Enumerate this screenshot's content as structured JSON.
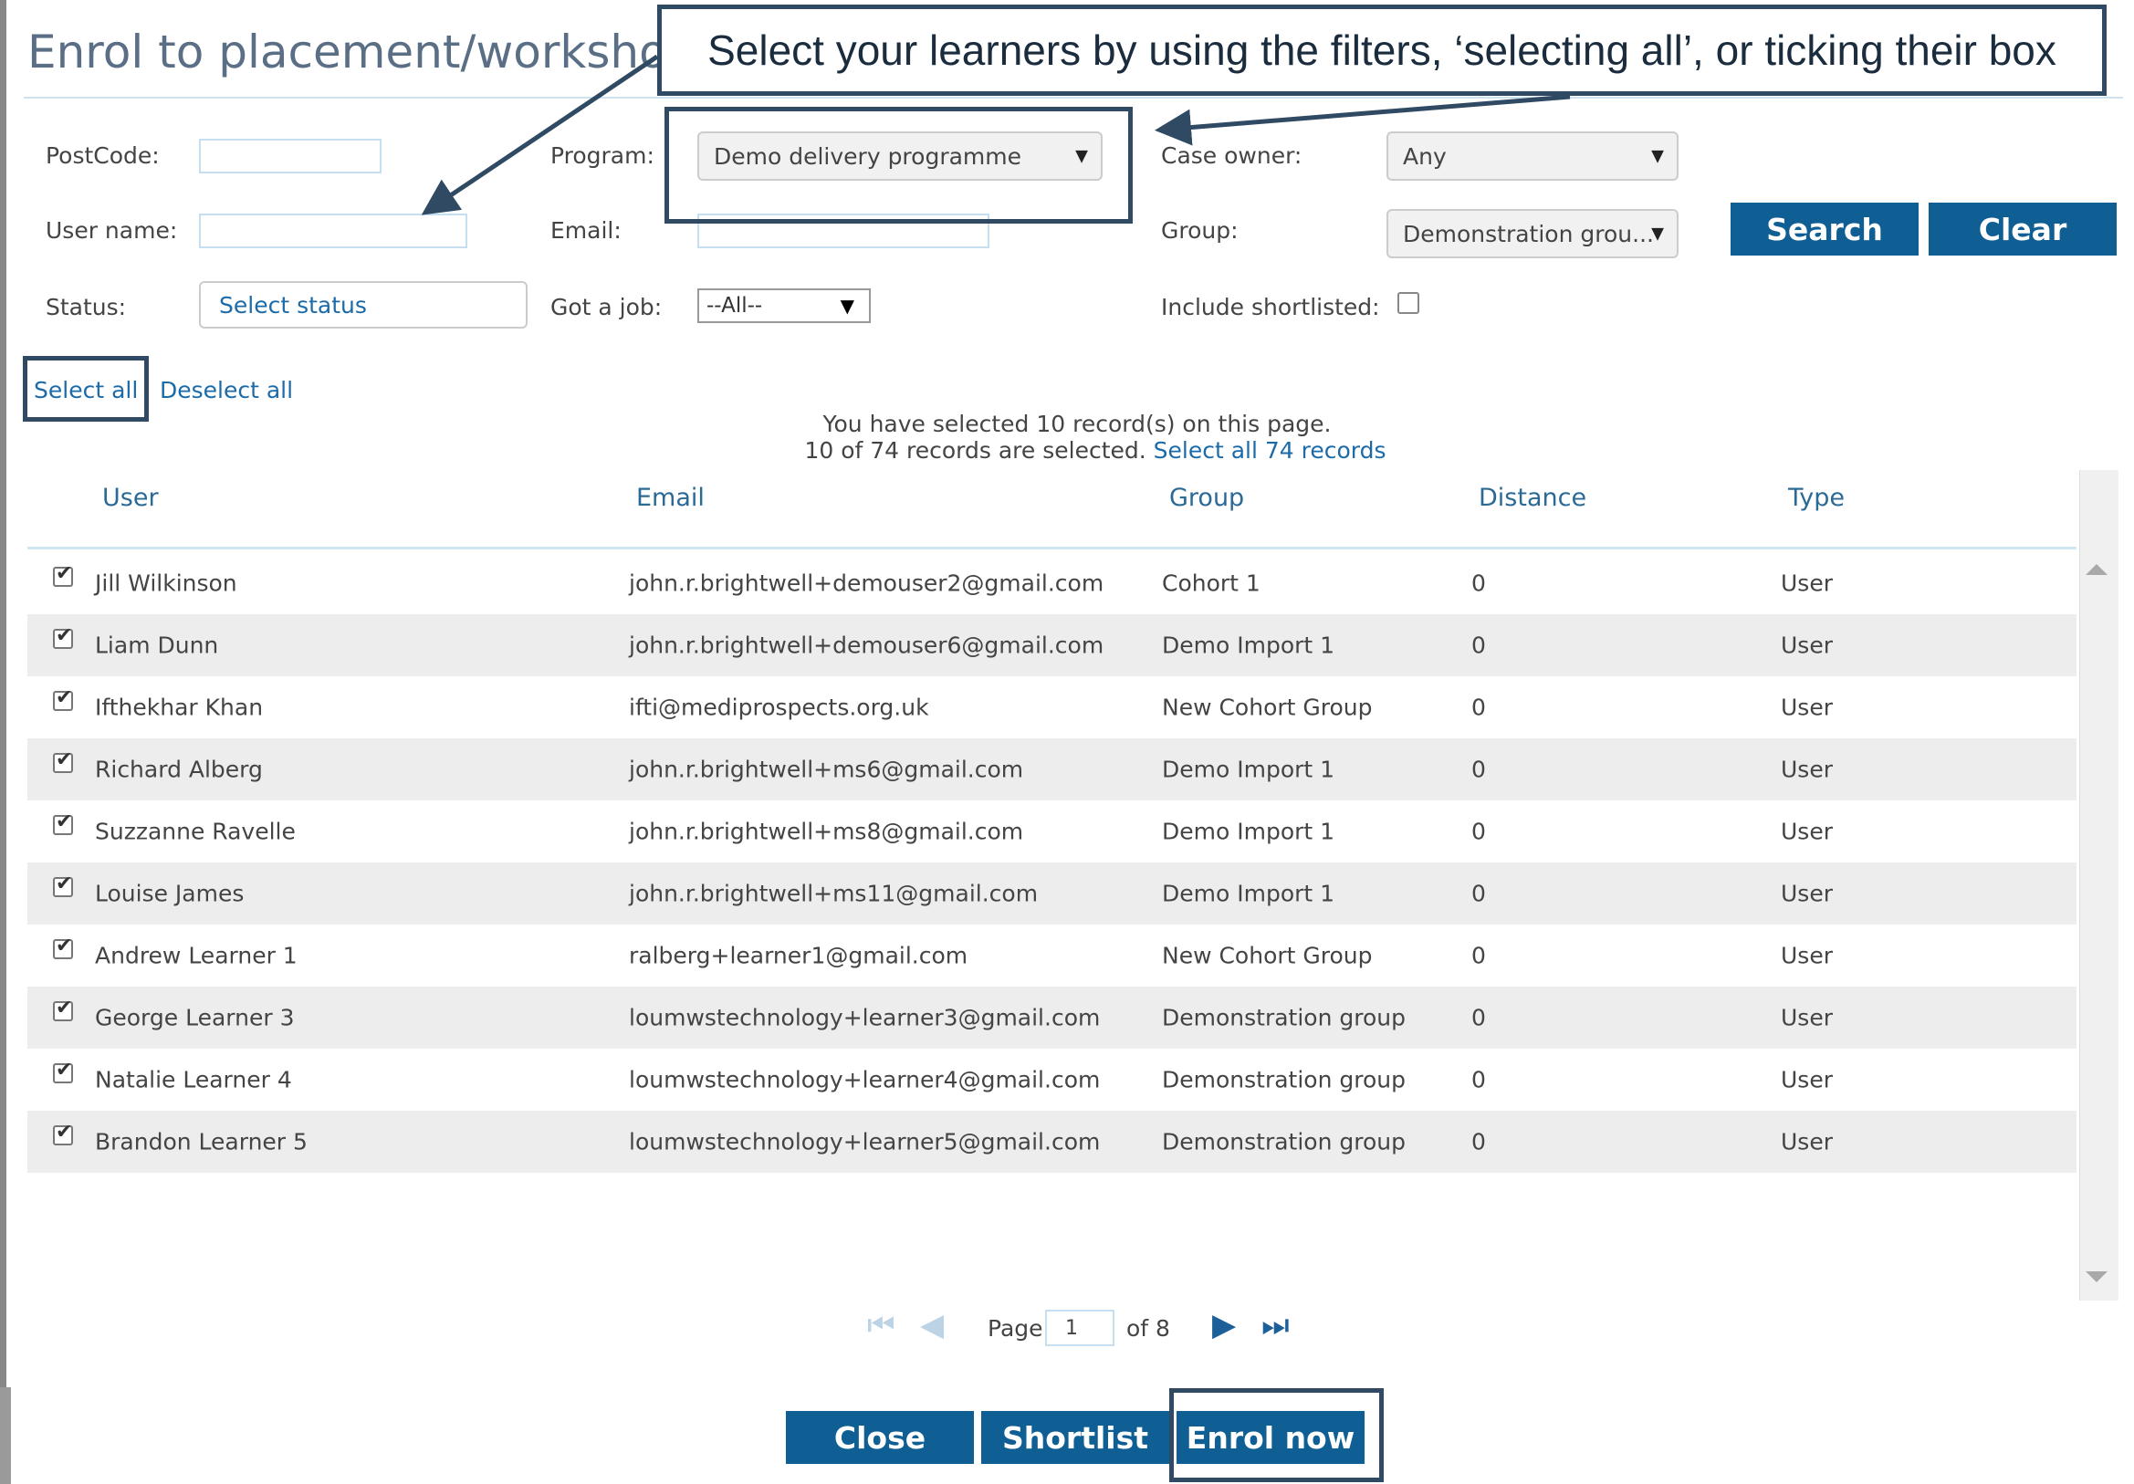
{
  "dialog": {
    "title": "Enrol to placement/workshop"
  },
  "callout": {
    "text": "Select your learners by using the filters, ‘selecting all’, or ticking their box"
  },
  "filters": {
    "postcode_label": "PostCode:",
    "username_label": "User name:",
    "status_label": "Status:",
    "status_placeholder": "Select status",
    "program_label": "Program:",
    "program_value": "Demo delivery programme",
    "email_label": "Email:",
    "gotjob_label": "Got a job:",
    "gotjob_value": "--All--",
    "caseowner_label": "Case owner:",
    "caseowner_value": "Any",
    "group_label": "Group:",
    "group_value": "Demonstration grou...",
    "shortlisted_label": "Include shortlisted:",
    "search_button": "Search",
    "clear_button": "Clear"
  },
  "selection": {
    "select_all": "Select all",
    "deselect_all": "Deselect all",
    "page_msg": "You have selected 10 record(s) on this page.",
    "records_msg": "10 of 74 records are selected.",
    "select_all_records": "Select all 74 records"
  },
  "table": {
    "columns": [
      "User",
      "Email",
      "Group",
      "Distance",
      "Type"
    ],
    "rows": [
      {
        "user": "Jill Wilkinson",
        "email": "john.r.brightwell+demouser2@gmail.com",
        "group": "Cohort 1",
        "distance": "0",
        "type": "User"
      },
      {
        "user": "Liam Dunn",
        "email": "john.r.brightwell+demouser6@gmail.com",
        "group": "Demo Import 1",
        "distance": "0",
        "type": "User"
      },
      {
        "user": "Ifthekhar Khan",
        "email": "ifti@mediprospects.org.uk",
        "group": "New Cohort Group",
        "distance": "0",
        "type": "User"
      },
      {
        "user": "Richard Alberg",
        "email": "john.r.brightwell+ms6@gmail.com",
        "group": "Demo Import 1",
        "distance": "0",
        "type": "User"
      },
      {
        "user": "Suzzanne Ravelle",
        "email": "john.r.brightwell+ms8@gmail.com",
        "group": "Demo Import 1",
        "distance": "0",
        "type": "User"
      },
      {
        "user": "Louise James",
        "email": "john.r.brightwell+ms11@gmail.com",
        "group": "Demo Import 1",
        "distance": "0",
        "type": "User"
      },
      {
        "user": "Andrew Learner 1",
        "email": "ralberg+learner1@gmail.com",
        "group": "New Cohort Group",
        "distance": "0",
        "type": "User"
      },
      {
        "user": "George Learner 3",
        "email": "loumwstechnology+learner3@gmail.com",
        "group": "Demonstration group",
        "distance": "0",
        "type": "User"
      },
      {
        "user": "Natalie Learner 4",
        "email": "loumwstechnology+learner4@gmail.com",
        "group": "Demonstration group",
        "distance": "0",
        "type": "User"
      },
      {
        "user": "Brandon Learner 5",
        "email": "loumwstechnology+learner5@gmail.com",
        "group": "Demonstration group",
        "distance": "0",
        "type": "User"
      }
    ]
  },
  "pager": {
    "page_label": "Page",
    "current_page": "1",
    "of_label": "of 8"
  },
  "footer": {
    "close_button": "Close",
    "shortlist_button": "Shortlist",
    "enrol_button": "Enrol now"
  },
  "colors": {
    "primary": "#0f5f95",
    "annotation": "#2f4a62",
    "link": "#1c6ba8"
  }
}
